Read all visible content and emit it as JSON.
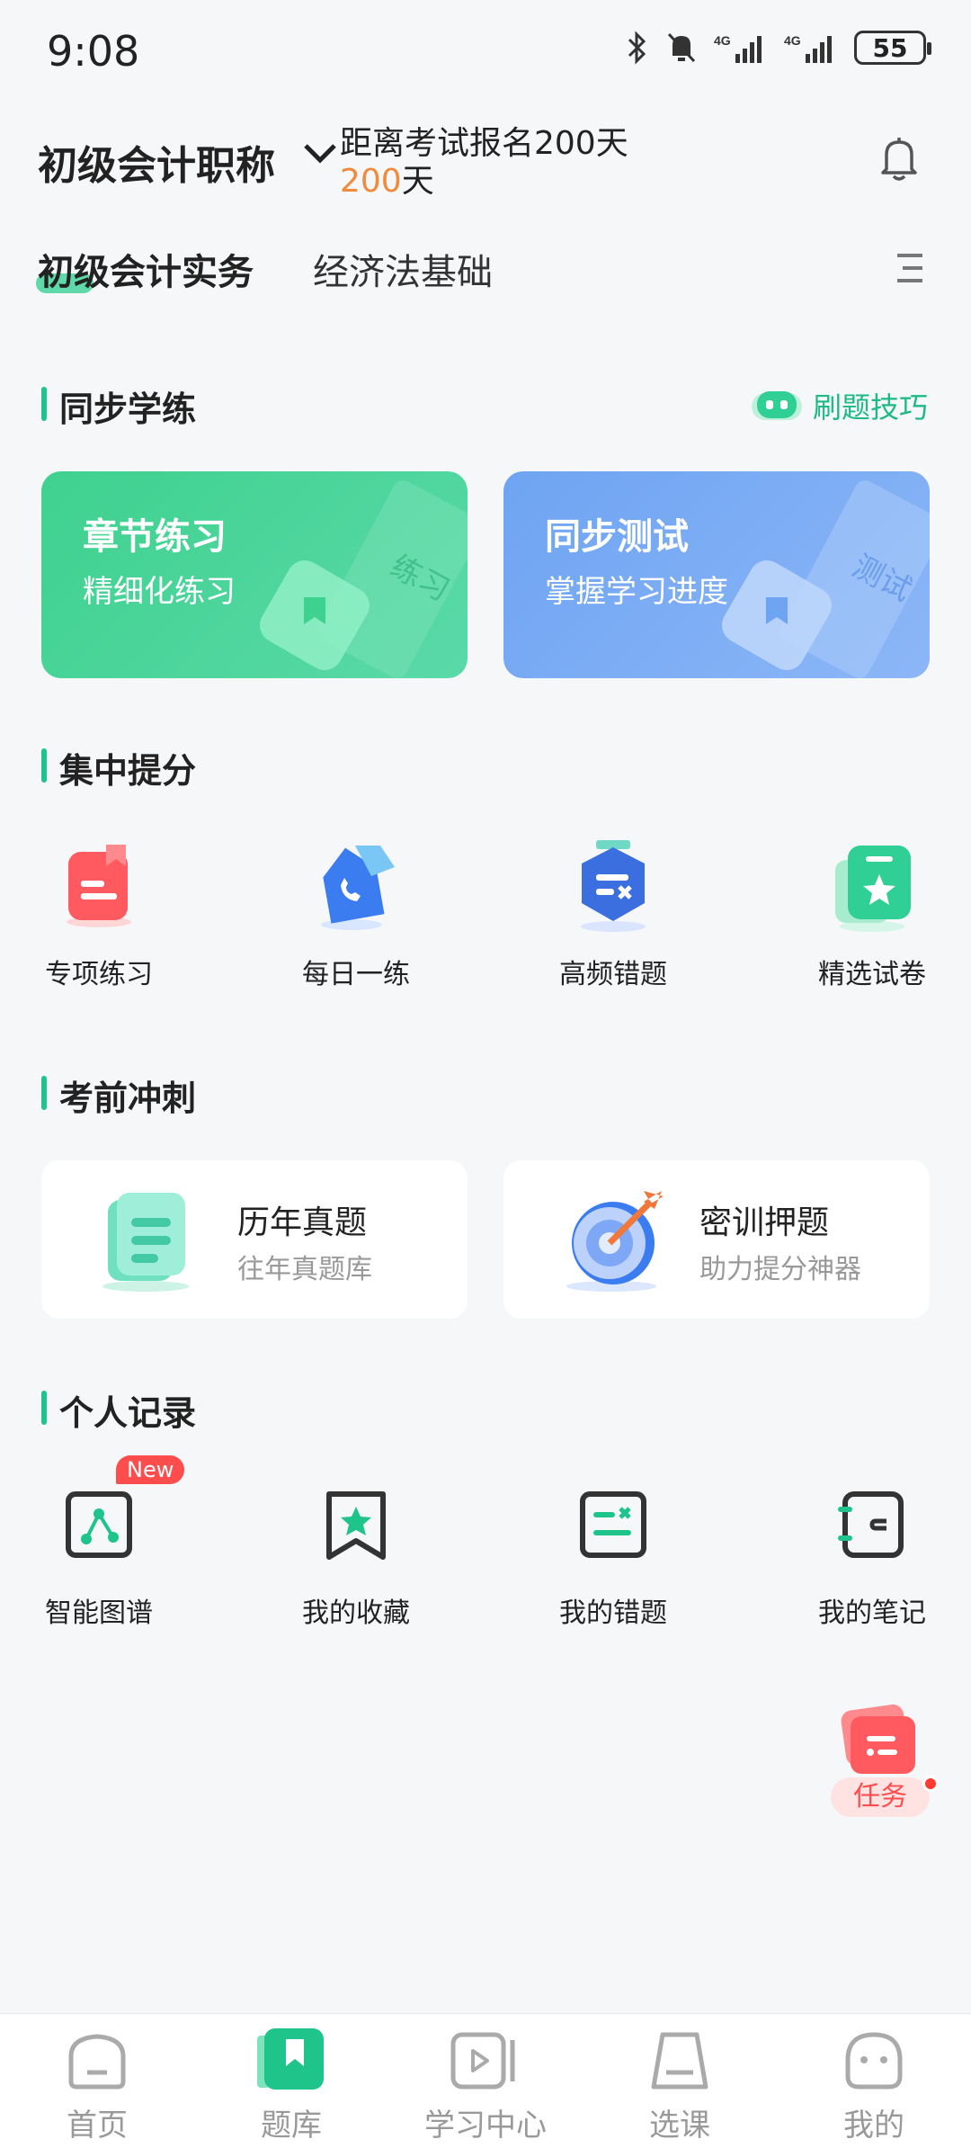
{
  "status_bar": {
    "time": "9:08",
    "battery": "55"
  },
  "header": {
    "exam_title": "初级会计职称",
    "countdown_prefix": "距离考试报名200天",
    "countdown_num": "200",
    "countdown_suffix": "天"
  },
  "tabs": [
    {
      "label": "初级会计实务"
    },
    {
      "label": "经济法基础"
    }
  ],
  "sections": {
    "sync": {
      "title": "同步学练",
      "tips_label": "刷题技巧"
    },
    "focus": {
      "title": "集中提分"
    },
    "sprint": {
      "title": "考前冲刺"
    },
    "records": {
      "title": "个人记录"
    }
  },
  "sync_cards": [
    {
      "title": "章节练习",
      "subtitle": "精细化练习",
      "deco_text": "练习"
    },
    {
      "title": "同步测试",
      "subtitle": "掌握学习进度",
      "deco_text": "测试"
    }
  ],
  "focus_items": [
    {
      "label": "专项练习",
      "icon": "bookmark-doc-icon",
      "color": "#ff5a5f"
    },
    {
      "label": "每日一练",
      "icon": "daily-phone-icon",
      "color": "#3b7cf0"
    },
    {
      "label": "高频错题",
      "icon": "hex-error-icon",
      "color": "#3b6fe0"
    },
    {
      "label": "精选试卷",
      "icon": "star-paper-icon",
      "color": "#2fcf95"
    }
  ],
  "sprint_cards": [
    {
      "title": "历年真题",
      "subtitle": "往年真题库",
      "icon": "stack-paper-icon"
    },
    {
      "title": "密训押题",
      "subtitle": "助力提分神器",
      "icon": "target-icon"
    }
  ],
  "record_items": [
    {
      "label": "智能图谱",
      "icon": "graph-icon",
      "badge": "New"
    },
    {
      "label": "我的收藏",
      "icon": "favorite-star-icon"
    },
    {
      "label": "我的错题",
      "icon": "wrong-question-icon"
    },
    {
      "label": "我的笔记",
      "icon": "notebook-icon"
    }
  ],
  "task_float": {
    "label": "任务"
  },
  "bottom_nav": [
    {
      "label": "首页",
      "icon": "home-icon"
    },
    {
      "label": "题库",
      "icon": "question-bank-icon"
    },
    {
      "label": "学习中心",
      "icon": "video-icon"
    },
    {
      "label": "选课",
      "icon": "course-bag-icon"
    },
    {
      "label": "我的",
      "icon": "profile-icon"
    }
  ],
  "colors": {
    "accent": "#1fc48a",
    "countdown": "#f08a3c",
    "badge": "#ff4d4d"
  }
}
